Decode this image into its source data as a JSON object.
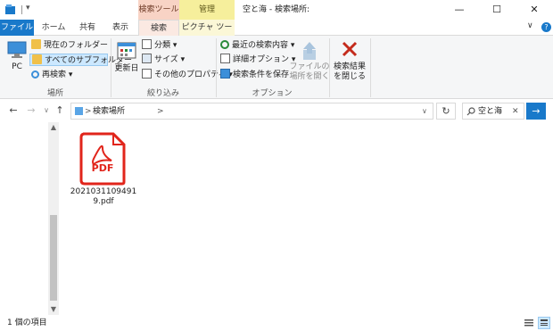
{
  "window": {
    "title": "空と海 - 検索場所:",
    "context_search_label": "検索ツール",
    "context_manage_label": "管理",
    "minimize": "—",
    "maximize": "☐",
    "close": "✕"
  },
  "tabs": {
    "file": "ファイル",
    "home": "ホーム",
    "share": "共有",
    "view": "表示",
    "search": "検索",
    "picture": "ピクチャ ツール"
  },
  "ribbon": {
    "location": {
      "label": "場所",
      "pc": "PC",
      "current_folder": "現在のフォルダー",
      "all_subfolders": "すべてのサブフォルダー",
      "search_again": "再検索 ▾"
    },
    "refine": {
      "label": "絞り込み",
      "date_modified": "更新日",
      "kind": "分類 ▾",
      "size": "サイズ ▾",
      "other_properties": "その他のプロパティ ▾"
    },
    "options": {
      "label": "オプション",
      "recent_searches": "最近の検索内容 ▾",
      "advanced": "詳細オプション ▾",
      "save_search": "検索条件を保存",
      "open_location_line1": "ファイルの",
      "open_location_line2": "場所を開く"
    },
    "close": {
      "line1": "検索結果",
      "line2": "を閉じる"
    }
  },
  "address": {
    "back": "←",
    "forward": "→",
    "recent": "∨",
    "up": "↑",
    "crumb": "検索場所",
    "chevron": ">",
    "chevron2": ">",
    "dropdown": "∨",
    "refresh": "↻",
    "search_value": "空と海",
    "search_clear": "✕",
    "search_go": "→"
  },
  "content": {
    "file_name": "20210311094919.pdf",
    "file_badge": "PDF"
  },
  "status": {
    "count": "1 個の項目"
  },
  "colors": {
    "accent": "#1979ca",
    "pdf_red": "#e1251b",
    "close_red": "#c42b1c"
  }
}
